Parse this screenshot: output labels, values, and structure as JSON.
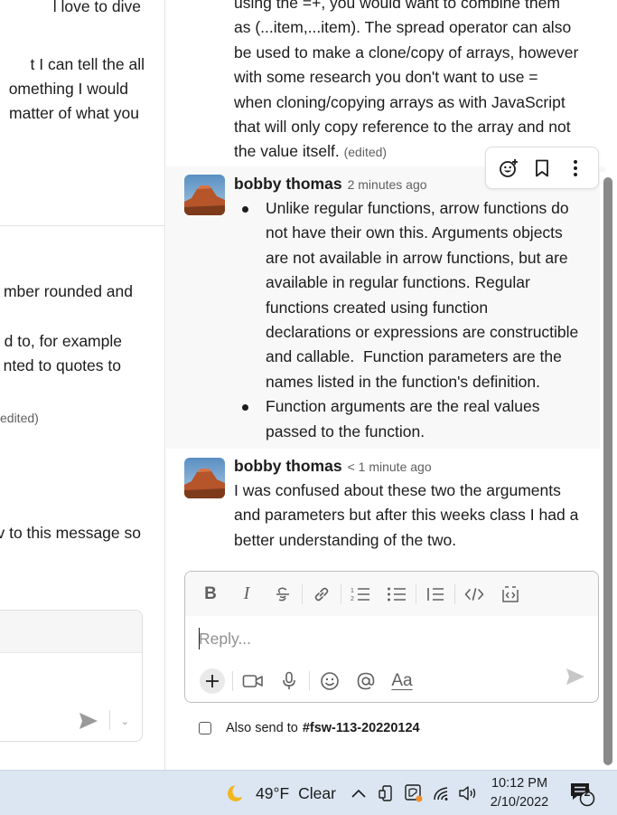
{
  "left_pane": {
    "lines": [
      "l love to dive",
      "t I can tell the all",
      "omething I would",
      "matter of what you",
      "mber rounded and",
      "d to, for example",
      "nted to quotes to",
      "edited)",
      "v to this message so"
    ]
  },
  "thread": {
    "msg1": {
      "lines": [
        "using the =+, you would want to combine them",
        "as (...item,...item). The spread operator can also",
        "be used to make a clone/copy of arrays, however",
        "with some research you don't want to use =",
        "when cloning/copying arrays as with JavaScript",
        "that will only copy reference to the array and not",
        "the value itself."
      ],
      "edited": "(edited)"
    },
    "msg2": {
      "author": "bobby thomas",
      "time": "2 minutes ago",
      "bullets": [
        [
          "Unlike regular functions, arrow functions do",
          "not have their own this. Arguments objects",
          "are not available in arrow functions, but are",
          "available in regular functions. Regular",
          "functions created using function",
          "declarations or expressions are constructible",
          "and callable.  Function parameters are the",
          "names listed in the function's definition."
        ],
        [
          "Function arguments are the real values",
          "passed to the function."
        ]
      ]
    },
    "msg3": {
      "author": "bobby thomas",
      "time": "< 1 minute ago",
      "lines": [
        "I was confused about these two the arguments",
        "and parameters but after this weeks class I had a",
        "better understanding of the two."
      ]
    },
    "actions": [
      "add-reaction-icon",
      "bookmark-icon",
      "more-actions-icon"
    ]
  },
  "composer": {
    "placeholder": "Reply...",
    "format_buttons": [
      "bold",
      "italic",
      "strikethrough",
      "link",
      "ordered-list",
      "bulleted-list",
      "blockquote",
      "code",
      "code-block"
    ],
    "bold_label": "B",
    "italic_label": "I",
    "aa_label": "Aa"
  },
  "also_send": {
    "label": "Also send to",
    "channel": "#fsw-113-20220124",
    "checked": false
  },
  "taskbar": {
    "weather_temp": "49°F",
    "weather_desc": "Clear",
    "time": "10:12 PM",
    "date": "2/10/2022",
    "notification_count": "2"
  },
  "colors": {
    "text": "#1d1c1d",
    "muted": "#616061",
    "hover_bg": "#f8f8f8",
    "taskbar": "#dbe6f2"
  }
}
